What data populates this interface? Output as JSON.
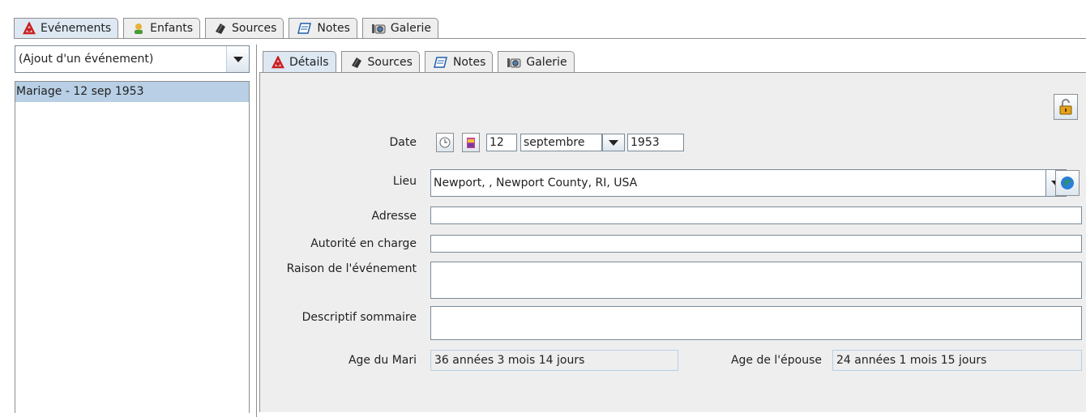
{
  "outer_tabs": [
    {
      "label": "Evénements",
      "icon": "events-icon"
    },
    {
      "label": "Enfants",
      "icon": "children-icon"
    },
    {
      "label": "Sources",
      "icon": "sources-icon"
    },
    {
      "label": "Notes",
      "icon": "notes-icon"
    },
    {
      "label": "Galerie",
      "icon": "gallery-icon"
    }
  ],
  "left": {
    "event_combo": "(Ajout d'un événement)",
    "events": [
      "Mariage - 12 sep 1953"
    ]
  },
  "inner_tabs": [
    {
      "label": "Détails",
      "icon": "details-icon"
    },
    {
      "label": "Sources",
      "icon": "sources-icon"
    },
    {
      "label": "Notes",
      "icon": "notes-icon"
    },
    {
      "label": "Galerie",
      "icon": "gallery-icon"
    }
  ],
  "form": {
    "date_label": "Date",
    "date_day": "12",
    "date_month": "septembre",
    "date_year": "1953",
    "lieu_label": "Lieu",
    "lieu_value": "Newport, , Newport County, RI, USA",
    "adresse_label": "Adresse",
    "adresse_value": "",
    "autorite_label": "Autorité en charge",
    "autorite_value": "",
    "raison_label": "Raison de l'événement",
    "raison_value": "",
    "descriptif_label": "Descriptif sommaire",
    "descriptif_value": "",
    "age_mari_label": "Age du Mari",
    "age_mari_value": "36 années 3 mois 14 jours",
    "age_epouse_label": "Age de l'épouse",
    "age_epouse_value": "24 années 1 mois 15 jours"
  }
}
